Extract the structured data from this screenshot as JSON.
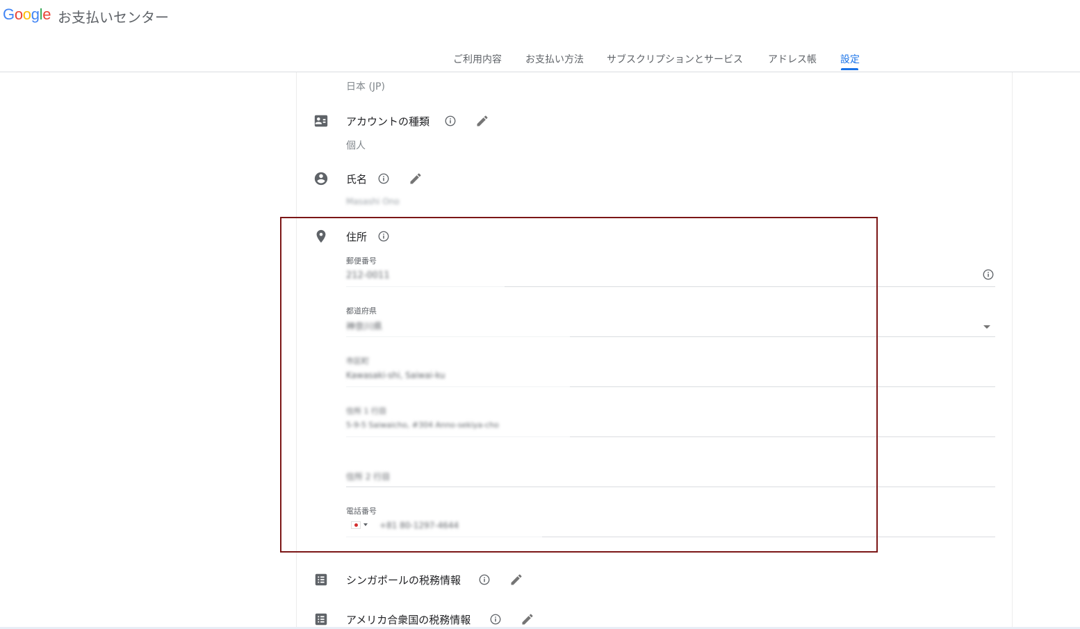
{
  "header": {
    "logo_letters": [
      {
        "char": "G",
        "color": "#4285F4"
      },
      {
        "char": "o",
        "color": "#EA4335"
      },
      {
        "char": "o",
        "color": "#FBBC05"
      },
      {
        "char": "g",
        "color": "#4285F4"
      },
      {
        "char": "l",
        "color": "#34A853"
      },
      {
        "char": "e",
        "color": "#EA4335"
      }
    ],
    "app_title": "お支払いセンター"
  },
  "tabs": [
    {
      "label": "ご利用内容",
      "active": false
    },
    {
      "label": "お支払い方法",
      "active": false
    },
    {
      "label": "サブスクリプションとサービス",
      "active": false
    },
    {
      "label": "アドレス帳",
      "active": false
    },
    {
      "label": "設定",
      "active": true
    }
  ],
  "accent_color": "#1a73e8",
  "settings": {
    "country_value": "日本 (JP)",
    "account_type": {
      "title": "アカウントの種類",
      "value": "個人",
      "icon": "account-card-icon"
    },
    "name": {
      "title": "氏名",
      "value": "Masashi Ono",
      "icon": "person-circle-icon"
    },
    "address": {
      "title": "住所",
      "icon": "location-pin-icon",
      "fields": {
        "postal_label": "郵便番号",
        "postal_value": "212-0011",
        "prefecture_label": "都道府県",
        "prefecture_value": "神奈川県",
        "city_label": "市区町",
        "city_value": "Kawasaki-shi, Saiwai-ku",
        "address1_label": "住所 1 行目",
        "address1_value": "5-9-5 Saiwaicho, #304 Anno-sekiya-cho",
        "address2_placeholder": "住所 2 行目",
        "phone_label": "電話番号",
        "phone_value": "+81 80-1297-4644"
      }
    },
    "singapore_tax": {
      "title": "シンガポールの税務情報",
      "icon": "list-icon"
    },
    "us_tax": {
      "title": "アメリカ合衆国の税務情報",
      "icon": "list-icon"
    }
  }
}
